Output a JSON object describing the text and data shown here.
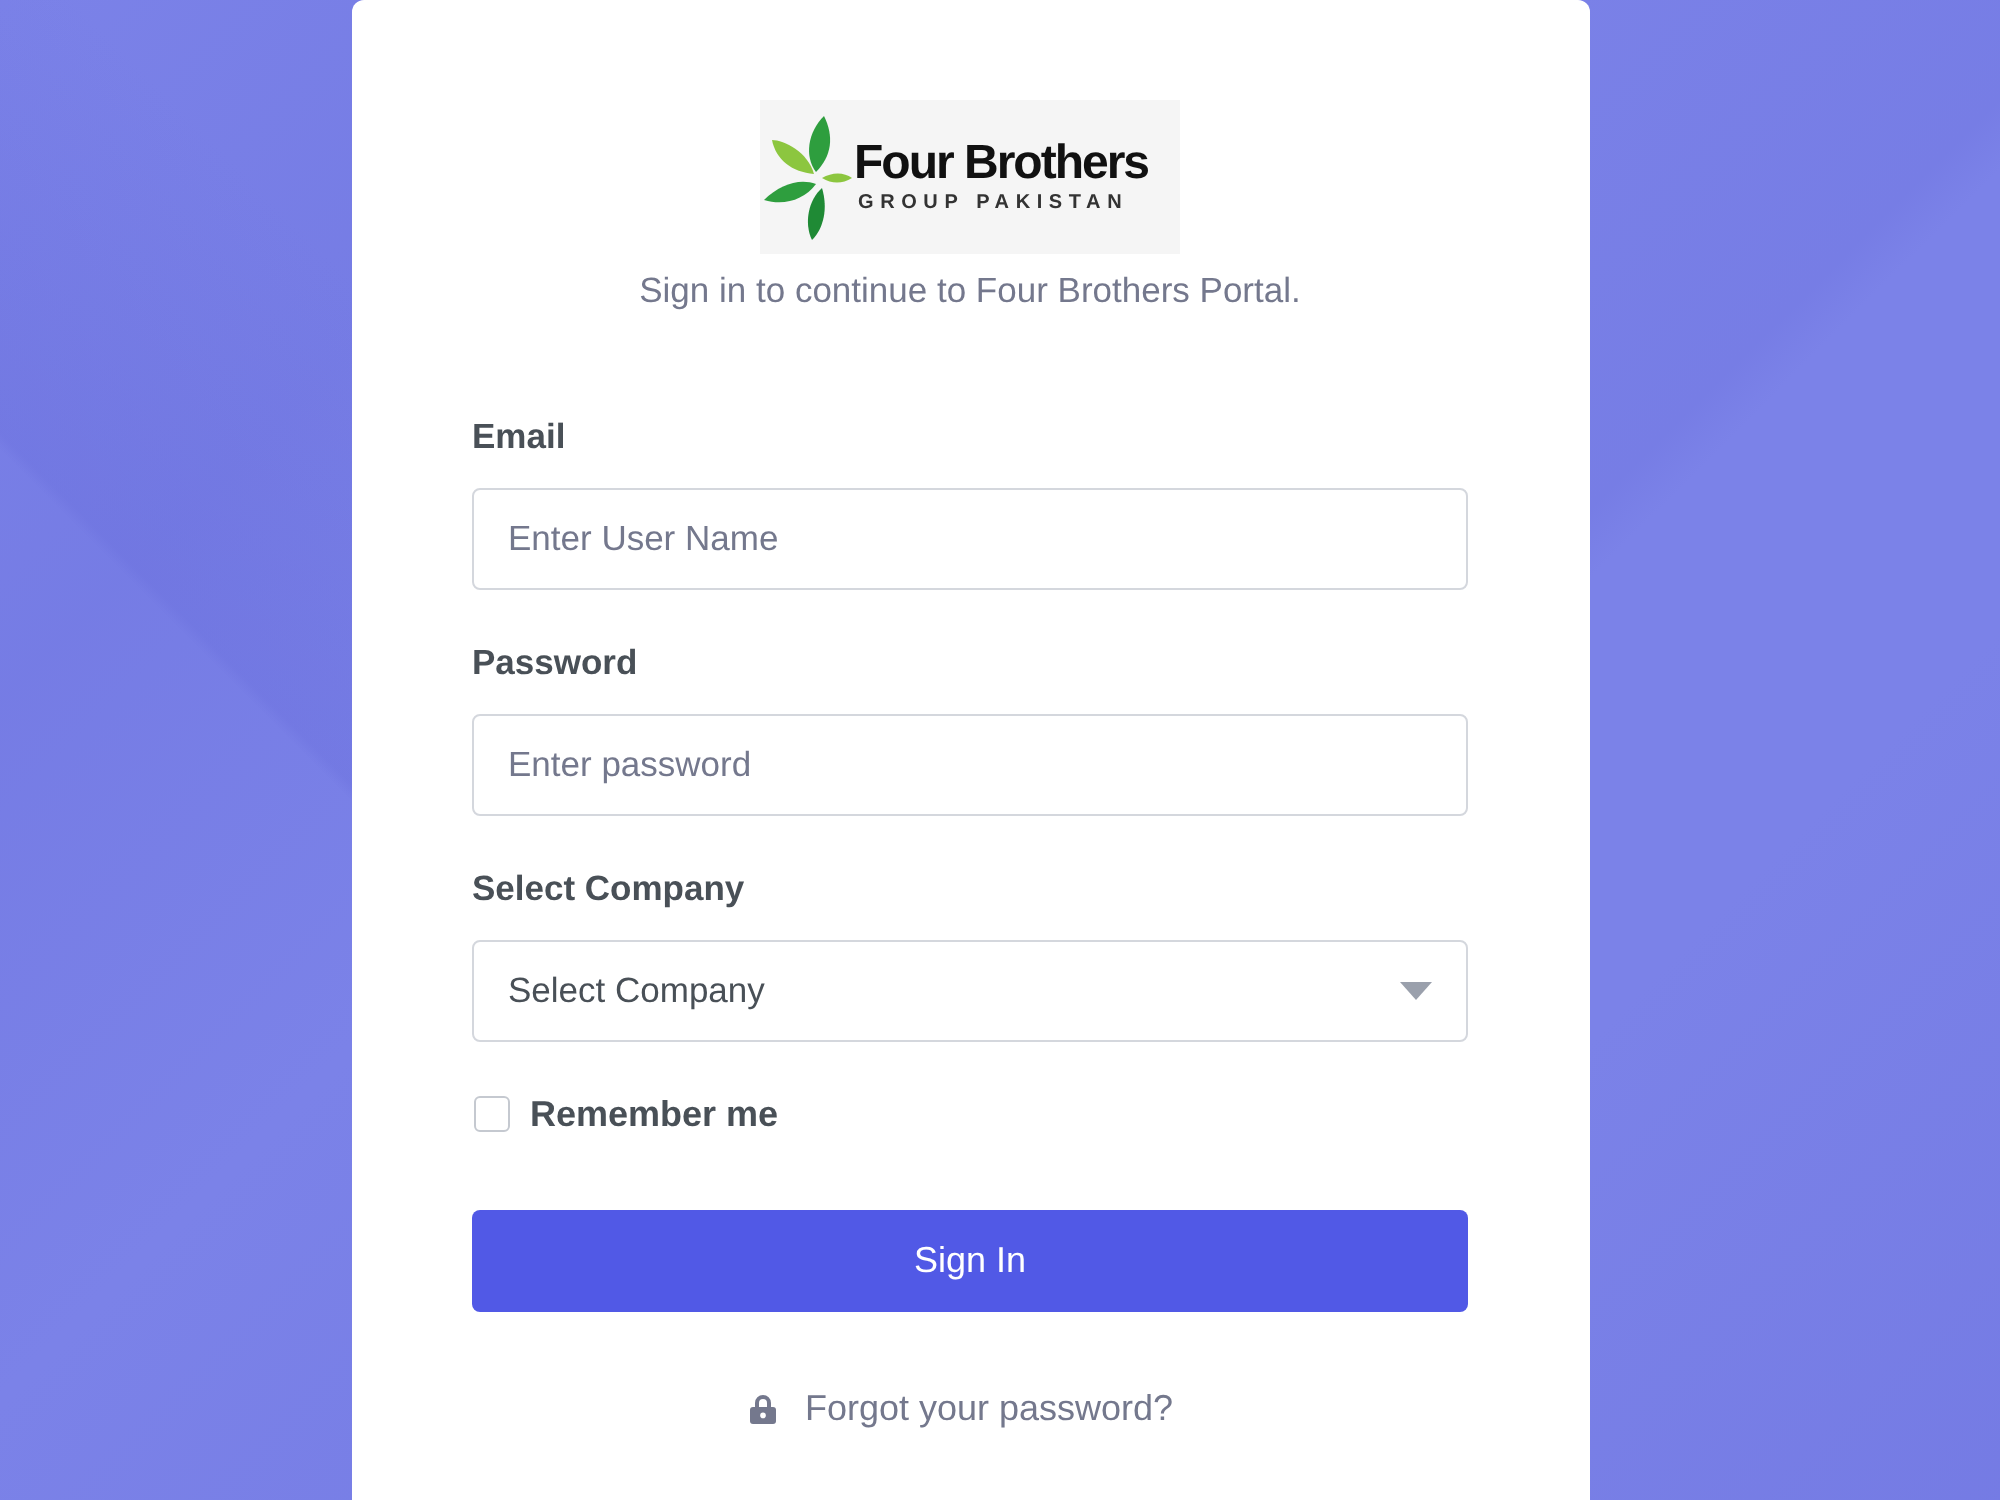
{
  "logo": {
    "title": "Four Brothers",
    "subtitle": "GROUP PAKISTAN"
  },
  "subtitle": "Sign in to continue to Four Brothers Portal.",
  "fields": [
    {
      "kind": "text",
      "label": "Email",
      "placeholder": "Enter User Name"
    },
    {
      "kind": "password",
      "label": "Password",
      "placeholder": "Enter password"
    },
    {
      "kind": "select",
      "label": "Select Company",
      "value": "Select Company"
    }
  ],
  "remember": {
    "label": "Remember me",
    "checked": false
  },
  "submit": "Sign In",
  "forgot": "Forgot your password?"
}
